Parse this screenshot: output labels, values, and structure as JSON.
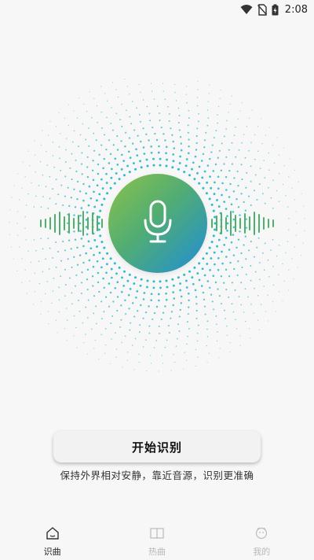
{
  "status_bar": {
    "time": "2:08",
    "icons": [
      "wifi-icon",
      "no-sim-icon",
      "battery-charging-icon"
    ]
  },
  "recognizer": {
    "mic_icon": "microphone-icon",
    "colors": {
      "gradient_start": "#8cc24a",
      "gradient_end": "#1f8ed6",
      "dots": "#21b6c9",
      "wave": "#4fb06e"
    }
  },
  "actions": {
    "start_label": "开始识别",
    "hint": "保持外界相对安静，靠近音源，识别更准确"
  },
  "bottom_nav": {
    "items": [
      {
        "label": "识曲",
        "icon": "home-icon",
        "active": true
      },
      {
        "label": "热曲",
        "icon": "book-icon",
        "active": false
      },
      {
        "label": "我的",
        "icon": "profile-face-icon",
        "active": false
      }
    ]
  }
}
